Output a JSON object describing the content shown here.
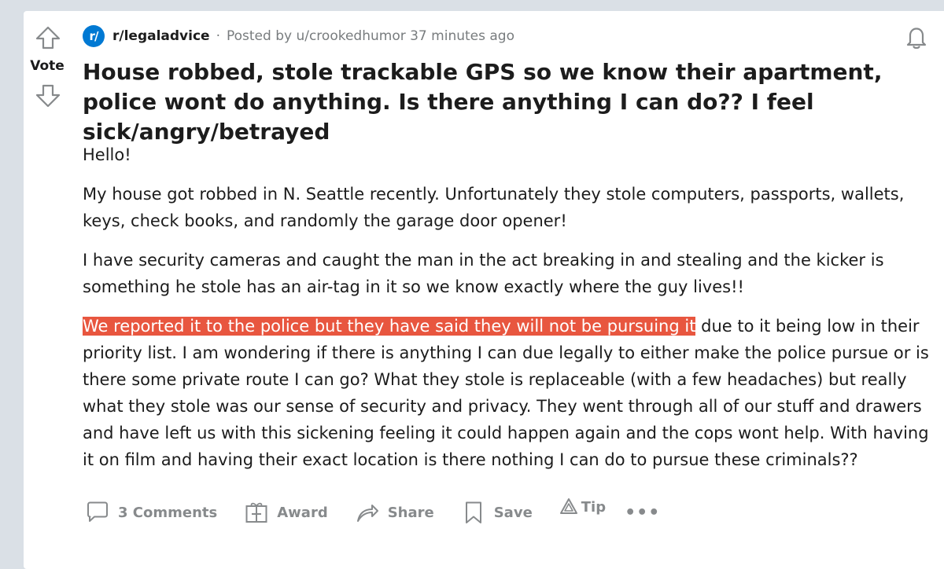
{
  "vote": {
    "label": "Vote"
  },
  "post": {
    "subreddit_icon_text": "r/",
    "subreddit": "r/legaladvice",
    "separator": "·",
    "posted_by": "Posted by u/crookedhumor 37 minutes ago",
    "title": "House robbed, stole trackable GPS so we know their apartment, police wont do anything. Is there anything I can do?? I feel sick/angry/betrayed",
    "paragraphs": {
      "p1": "Hello!",
      "p2": "My house got robbed in N. Seattle recently. Unfortunately they stole computers, passports, wallets, keys, check books, and randomly the garage door opener!",
      "p3": "I have security cameras and caught the man in the act breaking in and stealing and the kicker is something he stole has an air-tag in it so we know exactly where the guy lives!!",
      "p4_highlight": "We reported it to the police but they have said they will not be pursuing it",
      "p4_rest": " due to it being low in their priority list. I am wondering if there is anything I can due legally to either make the police pursue or is there some private route I can go? What they stole is replaceable (with a few headaches) but really what they stole was our sense of security and privacy. They went through all of our stuff and drawers and have left us with this sickening feeling it could happen again and the cops wont help. With having it on film and having their exact location is there nothing I can do to pursue these criminals??"
    }
  },
  "actions": {
    "comments": "3 Comments",
    "award": "Award",
    "share": "Share",
    "save": "Save",
    "tip": "Tip",
    "more": "•••"
  },
  "icons": {
    "upvote": "upvote-arrow-icon",
    "downvote": "downvote-arrow-icon",
    "bell": "bell-icon",
    "comment": "comment-bubble-icon",
    "award": "gift-icon",
    "share": "share-arrow-icon",
    "save": "bookmark-icon",
    "tip": "tip-icon"
  },
  "colors": {
    "subreddit_icon": "#0079d3",
    "highlight": "#e8563f",
    "meta_text": "#787c7e",
    "action_text": "#878a8c"
  }
}
